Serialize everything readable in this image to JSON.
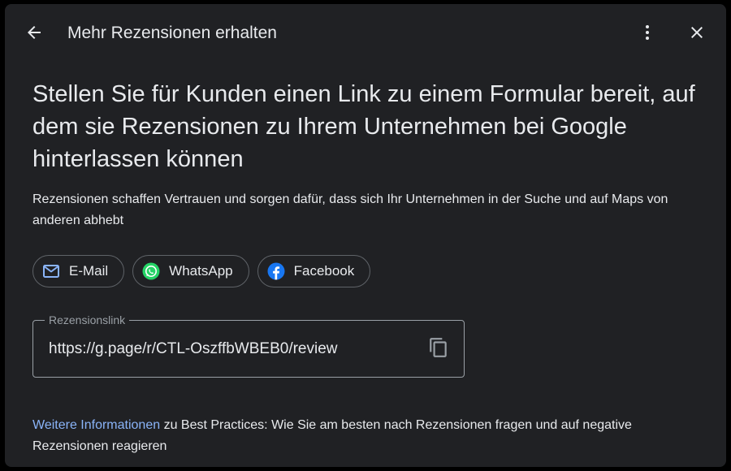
{
  "header": {
    "title": "Mehr Rezensionen erhalten",
    "back_icon": "arrow-back-icon",
    "more_icon": "more-vert-icon",
    "close_icon": "close-icon"
  },
  "main": {
    "headline": "Stellen Sie für Kunden einen Link zu einem Formular bereit, auf dem sie Rezensionen zu Ihrem Unternehmen bei Google hinterlassen können",
    "subtext": "Rezensionen schaffen Vertrauen und sorgen dafür, dass sich Ihr Unternehmen in der Suche und auf Maps von anderen abhebt"
  },
  "share": {
    "email_label": "E-Mail",
    "whatsapp_label": "WhatsApp",
    "facebook_label": "Facebook",
    "email_icon": "mail-icon",
    "whatsapp_icon": "whatsapp-icon",
    "facebook_icon": "facebook-icon"
  },
  "review_link": {
    "label": "Rezensionslink",
    "value": "https://g.page/r/CTL-OszffbWBEB0/review",
    "copy_icon": "copy-icon"
  },
  "footer": {
    "link_text": "Weitere Informationen",
    "rest_text": " zu Best Practices: Wie Sie am besten nach Rezensionen fragen und auf negative Rezensionen reagieren"
  },
  "colors": {
    "background": "#202124",
    "text": "#e8eaed",
    "link": "#8ab4f8",
    "whatsapp": "#25d366",
    "facebook": "#1877f2",
    "email_icon": "#8ab4f8"
  }
}
